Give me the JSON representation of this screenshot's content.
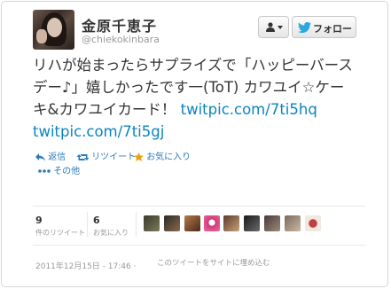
{
  "profile": {
    "name": "金原千恵子",
    "handle": "@chiekokinbara"
  },
  "buttons": {
    "follow_label": "フォロー"
  },
  "tweet": {
    "text_line1": "リハが始まったらサプライズで「ハッピーバース",
    "text_line2a": "デー♪」嬉しかったです一(ToT) カワユイ☆ケー",
    "text_line3a": "キ&カワユイカード！ ",
    "link1": "twitpic.com/7ti5hq",
    "link2": "twitpic.com/7ti5gj"
  },
  "actions": {
    "reply": "返信",
    "retweet": "リツイート",
    "favorite": "お気に入り",
    "more": "その他"
  },
  "stats": {
    "retweets_count": "9",
    "retweets_label": "件のリツイート",
    "favorites_count": "6",
    "favorites_label": "お気に入り"
  },
  "footer": {
    "timestamp": "2011年12月15日 - 17:46",
    "separator": "·",
    "embed_label": "このツイートをサイトに埋め込む"
  },
  "colors": {
    "link": "#0a84c1",
    "action": "#2b7bb9",
    "favorite_star": "#e8a112",
    "text": "#333333",
    "muted": "#999999"
  }
}
